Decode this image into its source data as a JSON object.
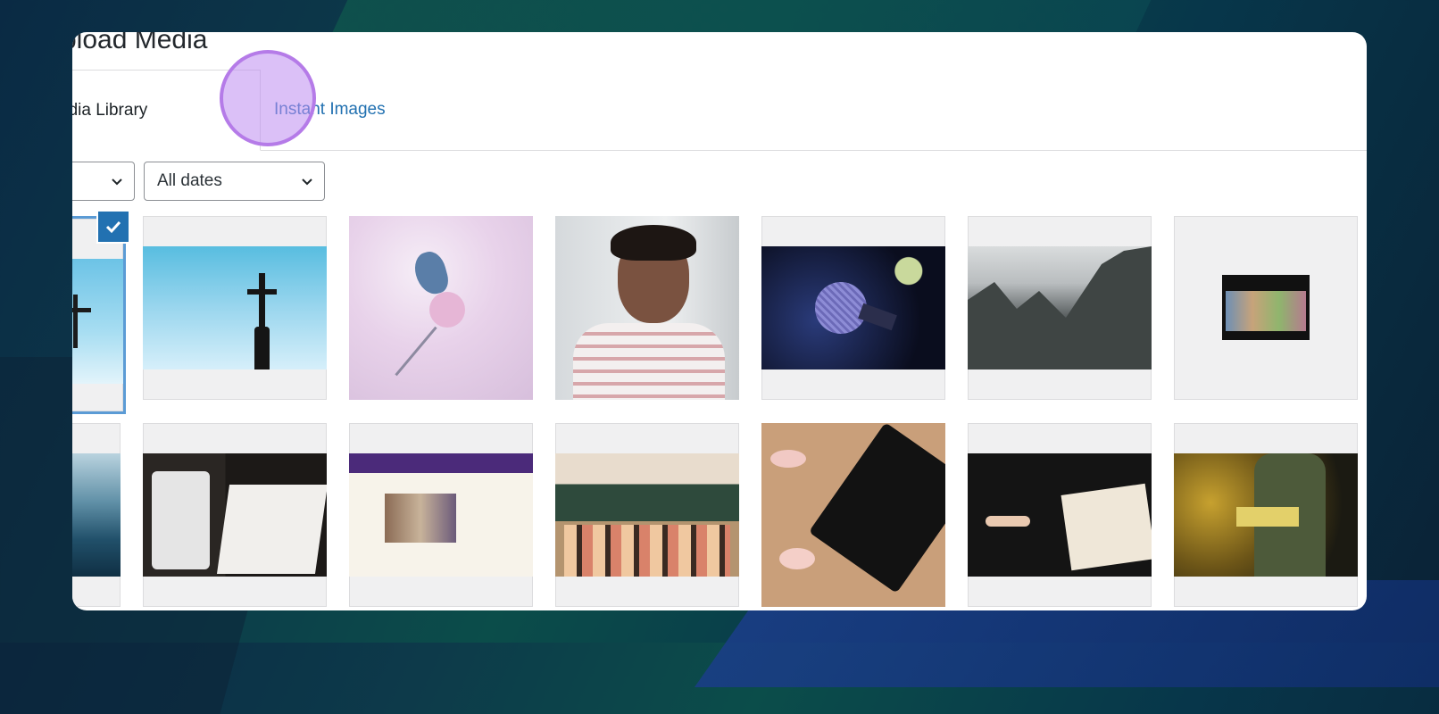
{
  "title": "Upload Media",
  "title_visible": "pload Media",
  "tabs": [
    {
      "label": "edia Library",
      "full_label": "Media Library",
      "active": true
    },
    {
      "label": "Instant Images",
      "active": false
    }
  ],
  "filters": {
    "type_select": {
      "value": ""
    },
    "dates_select": {
      "value": "All dates"
    }
  },
  "media_grid": {
    "selected_index": 0,
    "items": [
      {
        "name": "sky-cross-selected",
        "row": 1
      },
      {
        "name": "sky-cross",
        "row": 1
      },
      {
        "name": "butterfly-pink-flowers",
        "row": 1
      },
      {
        "name": "man-glasses-thinking",
        "row": 1
      },
      {
        "name": "microphone",
        "row": 1
      },
      {
        "name": "mountains",
        "row": 1
      },
      {
        "name": "group-video-thumbnail",
        "row": 1
      },
      {
        "name": "ocean-waves",
        "row": 2
      },
      {
        "name": "notebook-desk",
        "row": 2
      },
      {
        "name": "website-screenshot",
        "row": 2
      },
      {
        "name": "classroom",
        "row": 2
      },
      {
        "name": "holy-bible-tulips",
        "row": 2
      },
      {
        "name": "writing-bible-coffee",
        "row": 2
      },
      {
        "name": "reading-bible",
        "row": 2
      }
    ]
  },
  "colors": {
    "accent": "#2271b1",
    "cursor": "#b57be8",
    "selected_border": "#5b9bd5"
  }
}
